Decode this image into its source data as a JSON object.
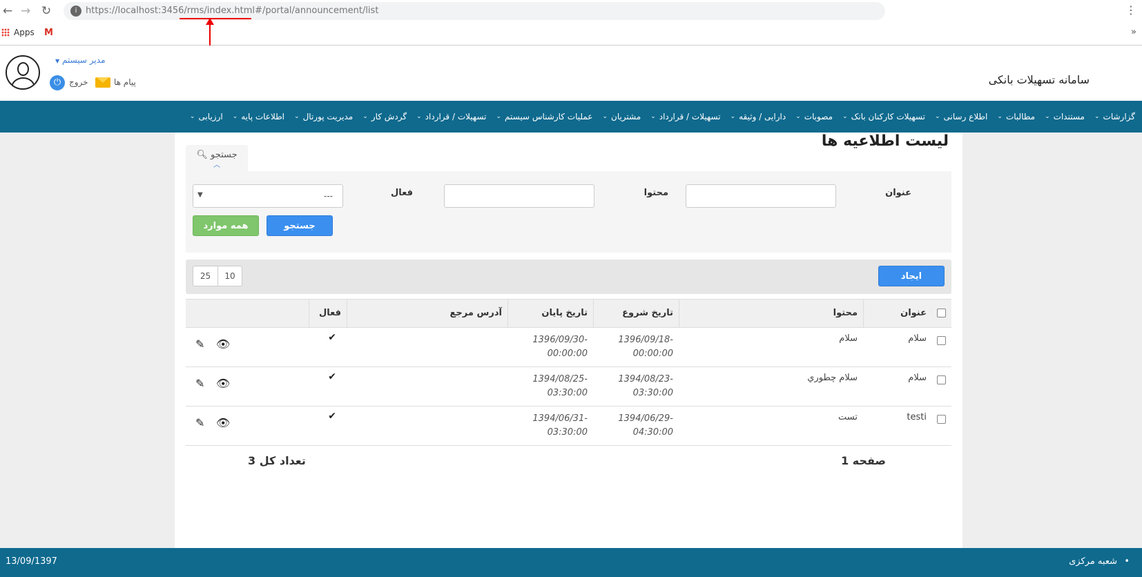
{
  "browser": {
    "url_host": "https://localhost",
    "url_port": ":3456",
    "url_path": "/rms/index.html",
    "url_hash": "#/portal/announcement/list",
    "bookmark_apps": "Apps"
  },
  "header": {
    "app_title": "سامانه تسهیلات بانکی",
    "user_name": "مدیر سیستم",
    "logout_label": "خروج",
    "messages_label": "پیام ها"
  },
  "menu": {
    "items": [
      {
        "label": "ارزیابی"
      },
      {
        "label": "اطلاعات پایه"
      },
      {
        "label": "مدیریت پورتال"
      },
      {
        "label": "گردش کار"
      },
      {
        "label": "تسهیلات / قرارداد"
      },
      {
        "label": "عملیات کارشناس سیستم"
      },
      {
        "label": "مشتریان"
      },
      {
        "label": "تسهیلات / قرارداد"
      },
      {
        "label": "دارایی / وثیقه"
      },
      {
        "label": "مصوبات"
      },
      {
        "label": "تسهیلات کارکنان بانک"
      },
      {
        "label": "اطلاع رسانی"
      },
      {
        "label": "مطالبات"
      },
      {
        "label": "مستندات"
      },
      {
        "label": "گزارشات"
      }
    ]
  },
  "page": {
    "title": "لیست اطلاعیه ها",
    "search_tab": "جستجو"
  },
  "search": {
    "title_label": "عنوان",
    "content_label": "محتوا",
    "active_label": "فعال",
    "active_selected": "---",
    "search_button": "جستجو",
    "all_button": "همه موارد"
  },
  "toolbar": {
    "create_button": "ایجاد",
    "page_sizes": [
      "10",
      "25"
    ]
  },
  "table": {
    "headers": {
      "title": "عنوان",
      "content": "محتوا",
      "start_date": "تاریخ شروع",
      "end_date": "تاریخ پایان",
      "ref_address": "آدرس مرجع",
      "active": "فعال"
    },
    "rows": [
      {
        "title": "سلام",
        "content": "سلام",
        "start_1": "1396/09/18-",
        "start_2": "00:00:00",
        "end_1": "1396/09/30-",
        "end_2": "00:00:00",
        "active": true
      },
      {
        "title": "سلام",
        "content": "سلام چطوري",
        "start_1": "1394/08/23-",
        "start_2": "03:30:00",
        "end_1": "1394/08/25-",
        "end_2": "03:30:00",
        "active": true
      },
      {
        "title": "testi",
        "content": "تست",
        "start_1": "1394/06/29-",
        "start_2": "04:30:00",
        "end_1": "1394/06/31-",
        "end_2": "03:30:00",
        "active": true
      }
    ]
  },
  "footer": {
    "page_label": "صفحه 1",
    "total_label": "تعداد کل 3"
  },
  "status": {
    "date": "13/09/1397",
    "branch": "شعبه مرکزی"
  },
  "colors": {
    "menu_bg": "#0f6a8e",
    "primary_button": "#3b8fef",
    "success_button": "#7fc66c",
    "annotation": "#e00000"
  }
}
